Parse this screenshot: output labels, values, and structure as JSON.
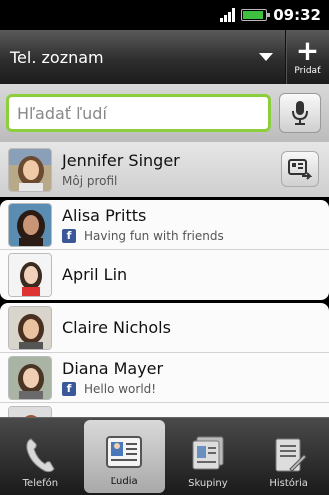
{
  "status": {
    "time": "09:32"
  },
  "header": {
    "title": "Tel. zoznam",
    "add_label": "Pridať"
  },
  "search": {
    "placeholder": "Hľadať ľudí"
  },
  "contacts": [
    {
      "name": "Jennifer Singer",
      "subtitle": "Môj profil"
    },
    {
      "name": "Alisa Pritts",
      "subtitle": "Having fun with friends",
      "source": "facebook"
    },
    {
      "name": "April Lin"
    },
    {
      "name": "Claire Nichols"
    },
    {
      "name": "Diana Mayer",
      "subtitle": "Hello world!",
      "source": "facebook"
    }
  ],
  "tabs": [
    {
      "label": "Telefón"
    },
    {
      "label": "Ľudia",
      "active": true
    },
    {
      "label": "Skupiny"
    },
    {
      "label": "História"
    }
  ],
  "colors": {
    "search_border": "#8ccf3c",
    "facebook": "#3b5998"
  }
}
